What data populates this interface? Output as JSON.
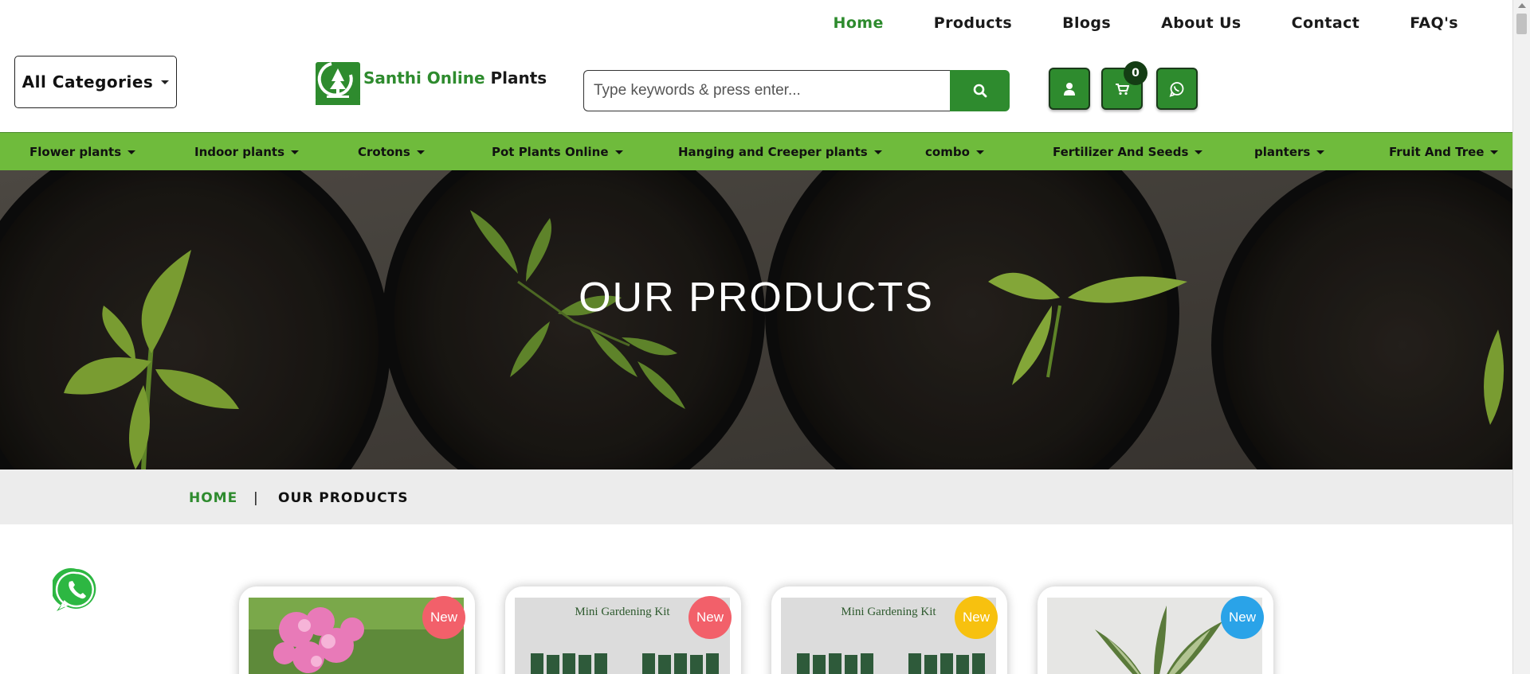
{
  "top_nav": {
    "items": [
      {
        "label": "Home",
        "active": true
      },
      {
        "label": "Products"
      },
      {
        "label": "Blogs"
      },
      {
        "label": "About Us"
      },
      {
        "label": "Contact"
      },
      {
        "label": "FAQ's"
      }
    ]
  },
  "header": {
    "categories_label": "All Categories",
    "logo": {
      "green": "Santhi Online",
      "dark": "Plants"
    },
    "search": {
      "placeholder": "Type keywords & press enter...",
      "value": ""
    },
    "cart_count": "0",
    "icons": [
      "user-icon",
      "cart-icon",
      "whatsapp-icon"
    ]
  },
  "category_bar": {
    "items": [
      "Flower plants",
      "Indoor plants",
      "Crotons",
      "Pot Plants Online",
      "Hanging and Creeper plants",
      "combo",
      "Fertilizer And Seeds",
      "planters",
      "Fruit And Tree"
    ]
  },
  "hero": {
    "title": "OUR PRODUCTS"
  },
  "breadcrumb": {
    "home": "HOME",
    "separator": "|",
    "current": "OUR PRODUCTS"
  },
  "products": [
    {
      "badge": "New",
      "badge_color": "#f2606a"
    },
    {
      "badge": "New",
      "badge_color": "#f2606a",
      "kit_title": "Mini Gardening Kit"
    },
    {
      "badge": "New",
      "badge_color": "#f7c10f",
      "kit_title": "Mini Gardening Kit"
    },
    {
      "badge": "New",
      "badge_color": "#2aa3e8"
    }
  ],
  "colors": {
    "brand_green": "#2e8b2e",
    "category_bar": "#6fbb3c"
  }
}
